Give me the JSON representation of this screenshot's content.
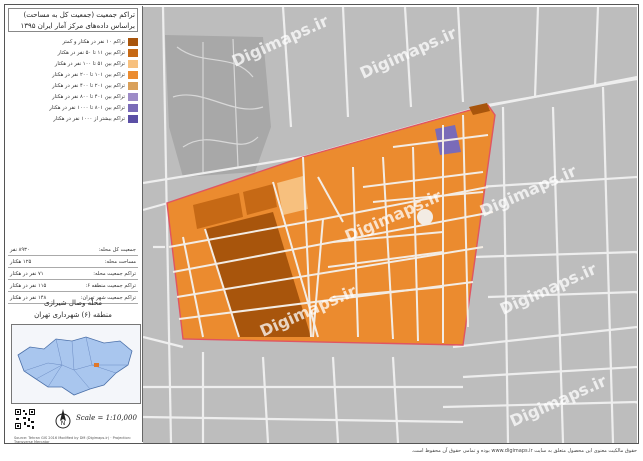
{
  "title": {
    "line1": "تراکم جمعیت (جمعیت کل به مساحت)",
    "line2": "براساس داده‌های مرکز آمار ایران ۱۳۹۵"
  },
  "legend": [
    {
      "label": "تراکم ۱۰ نفر در هکتار و کمتر",
      "color": "#a8550c"
    },
    {
      "label": "تراکم بین ۱۱ تا ۵۰ نفر در هکتار",
      "color": "#c66915"
    },
    {
      "label": "تراکم بین ۵۱ تا ۱۰۰ نفر در هکتار",
      "color": "#f7c07e"
    },
    {
      "label": "تراکم بین ۱۰۱ تا ۲۰۰ نفر در هکتار",
      "color": "#eb8b2f"
    },
    {
      "label": "تراکم بین ۲۰۱ تا ۴۰۰ نفر در هکتار",
      "color": "#d9a05a"
    },
    {
      "label": "تراکم بین ۴۰۱ تا ۸۰۰ نفر در هکتار",
      "color": "#9d8bc7"
    },
    {
      "label": "تراکم بین ۸۰۱ تا ۱۰۰۰ نفر در هکتار",
      "color": "#7a6bb8"
    },
    {
      "label": "تراکم بیشتر از ۱۰۰۰ نفر در هکتار",
      "color": "#5b4fa5"
    }
  ],
  "stats": [
    {
      "label": "جمعیت کل محله:",
      "value": "۸۹۳۰ نفر"
    },
    {
      "label": "مساحت محله:",
      "value": "۱۲۵ هکتار"
    },
    {
      "label": "تراکم جمعیت محله:",
      "value": "۷۱ نفر در هکتار"
    },
    {
      "label": "تراکم جمعیت منطقه ۶:",
      "value": "۱۱۵ نفر در هکتار"
    },
    {
      "label": "تراکم جمعیت شهر تهران:",
      "value": "۱۴۸ نفر در هکتار"
    }
  ],
  "region": {
    "name": "محله وصال شیرازی",
    "district": "منطقه (۶) شهرداری تهران"
  },
  "scale_text": "Scale = 1:10,000",
  "credit_left": "Source: Tehran GIS 2016 Modified by DM (Digimaps.ir) · Projection: Transverse Mercator",
  "footer_text": "حقوق مالکیت معنوی این محصول متعلق به سایت www.digimaps.ir بوده و تمامی حقوق آن محفوظ است.",
  "watermark": "Digimaps.ir",
  "colors": {
    "basemap": "#bdbdbd",
    "street": "#eeeeee",
    "boundary": "#e05561",
    "inset_city": "#a9c6ee"
  }
}
